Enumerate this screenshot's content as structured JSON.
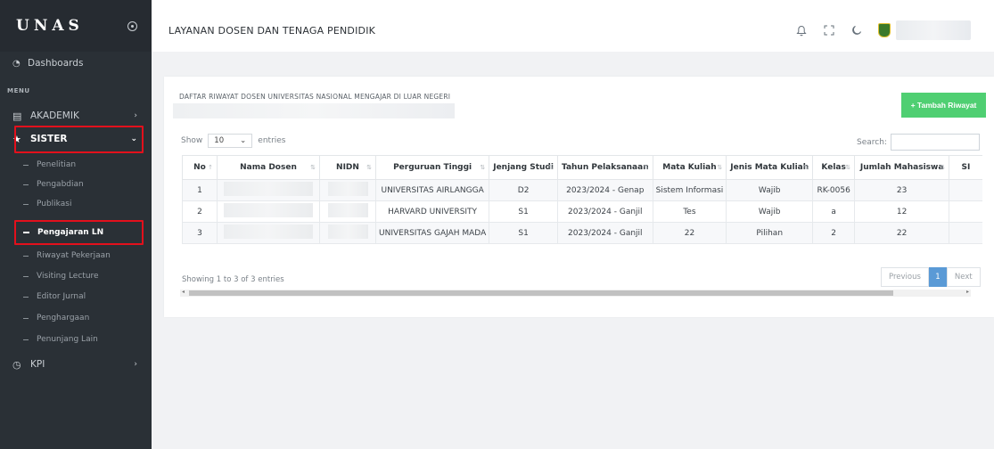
{
  "app": {
    "brand": "UNAS",
    "page_title": "LAYANAN DOSEN DAN TENAGA PENDIDIK"
  },
  "sidebar": {
    "dashboard": "Dashboards",
    "menu_label": "MENU",
    "items": [
      {
        "label": "AKADEMIK",
        "icon": "book-icon",
        "expanded": false
      },
      {
        "label": "SISTER",
        "icon": "star-icon",
        "expanded": true
      },
      {
        "label": "KPI",
        "icon": "clock-icon",
        "expanded": false
      }
    ],
    "sister_sub": [
      "Penelitian",
      "Pengabdian",
      "Publikasi",
      "Pengajaran LN",
      "Riwayat Pekerjaan",
      "Visiting Lecture",
      "Editor Jurnal",
      "Penghargaan",
      "Penunjang Lain"
    ],
    "active_sub": "Pengajaran LN"
  },
  "header_icons": [
    "bell-icon",
    "fullscreen-icon",
    "moon-icon"
  ],
  "card": {
    "title": "DAFTAR RIWAYAT DOSEN UNIVERSITAS NASIONAL MENGAJAR DI LUAR NEGERI",
    "add_button": "+ Tambah Riwayat",
    "show_label": "Show",
    "entries_value": "10",
    "entries_label": "entries",
    "search_label": "Search:",
    "search_value": "",
    "info": "Showing 1 to 3 of 3 entries",
    "prev": "Previous",
    "page": "1",
    "next": "Next"
  },
  "table": {
    "headers": [
      "No",
      "Nama Dosen",
      "NIDN",
      "Perguruan Tinggi",
      "Jenjang Studi",
      "Tahun Pelaksanaan",
      "Mata Kuliah",
      "Jenis Mata Kuliah",
      "Kelas",
      "Jumlah Mahasiswa",
      "SI"
    ],
    "rows": [
      [
        "1",
        "",
        "",
        "UNIVERSITAS AIRLANGGA",
        "D2",
        "2023/2024 - Genap",
        "Sistem Informasi",
        "Wajib",
        "RK-0056",
        "23"
      ],
      [
        "2",
        "",
        "",
        "HARVARD UNIVERSITY",
        "S1",
        "2023/2024 - Ganjil",
        "Tes",
        "Wajib",
        "a",
        "12"
      ],
      [
        "3",
        "",
        "",
        "UNIVERSITAS GAJAH MADA",
        "S1",
        "2023/2024 - Ganjil",
        "22",
        "Pilihan",
        "2",
        "22"
      ]
    ]
  }
}
